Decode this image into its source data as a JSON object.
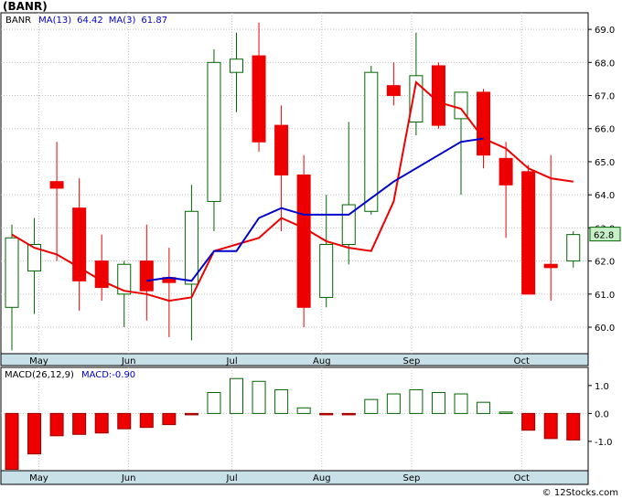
{
  "title": "(BANR)",
  "legend_price": [
    {
      "label": "BANR",
      "color": "#000000"
    },
    {
      "label": "MA(13)",
      "color": "#0000cc"
    },
    {
      "label": "64.42",
      "color": "#0000cc"
    },
    {
      "label": "MA(3)",
      "color": "#0000cc"
    },
    {
      "label": "61.87",
      "color": "#0000cc"
    }
  ],
  "legend_macd": [
    {
      "label": "MACD(26,12,9)",
      "color": "#000000"
    },
    {
      "label": "MACD:-0.90",
      "color": "#0000cc"
    }
  ],
  "last_price_label": "62.8",
  "credit": "© 12Stocks.com",
  "colors": {
    "up": "#006600",
    "down": "#ee0000",
    "ma13": "#0000cc",
    "ma3": "#ee0000",
    "panel_bg": "#ffffff",
    "axis_band": "#c8e0e8"
  },
  "chart_data": [
    {
      "type": "candlestick",
      "xlabels": [
        "May",
        "Jun",
        "Jul",
        "Aug",
        "Sep",
        "Oct"
      ],
      "xlabel_index": [
        1.2,
        5.2,
        9.8,
        13.8,
        17.8,
        22.7
      ],
      "ylim": [
        59.2,
        69.5
      ],
      "yticks": [
        60.0,
        61.0,
        62.0,
        63.0,
        64.0,
        65.0,
        66.0,
        67.0,
        68.0,
        69.0
      ],
      "candles": [
        {
          "o": 60.6,
          "h": 63.1,
          "l": 59.3,
          "c": 62.7
        },
        {
          "o": 61.7,
          "h": 63.3,
          "l": 60.4,
          "c": 62.5
        },
        {
          "o": 64.4,
          "h": 65.6,
          "l": 62.0,
          "c": 64.2
        },
        {
          "o": 63.6,
          "h": 64.5,
          "l": 60.5,
          "c": 61.4
        },
        {
          "o": 62.0,
          "h": 62.8,
          "l": 60.8,
          "c": 61.2
        },
        {
          "o": 61.0,
          "h": 62.0,
          "l": 60.0,
          "c": 61.9
        },
        {
          "o": 62.0,
          "h": 63.1,
          "l": 60.2,
          "c": 61.1
        },
        {
          "o": 61.5,
          "h": 62.4,
          "l": 59.7,
          "c": 61.35
        },
        {
          "o": 61.3,
          "h": 64.3,
          "l": 59.6,
          "c": 63.5
        },
        {
          "o": 63.8,
          "h": 68.4,
          "l": 62.9,
          "c": 68.0
        },
        {
          "o": 67.7,
          "h": 68.9,
          "l": 66.5,
          "c": 68.1
        },
        {
          "o": 68.2,
          "h": 69.2,
          "l": 65.3,
          "c": 65.6
        },
        {
          "o": 66.1,
          "h": 66.7,
          "l": 62.9,
          "c": 64.6
        },
        {
          "o": 64.6,
          "h": 65.2,
          "l": 60.0,
          "c": 60.6
        },
        {
          "o": 60.9,
          "h": 64.0,
          "l": 60.6,
          "c": 62.5
        },
        {
          "o": 62.5,
          "h": 66.2,
          "l": 61.9,
          "c": 63.7
        },
        {
          "o": 63.5,
          "h": 67.9,
          "l": 63.4,
          "c": 67.7
        },
        {
          "o": 67.3,
          "h": 68.0,
          "l": 66.7,
          "c": 67.0
        },
        {
          "o": 66.2,
          "h": 68.9,
          "l": 65.8,
          "c": 67.6
        },
        {
          "o": 67.9,
          "h": 68.0,
          "l": 66.0,
          "c": 66.1
        },
        {
          "o": 66.3,
          "h": 67.1,
          "l": 64.0,
          "c": 67.1
        },
        {
          "o": 67.1,
          "h": 67.2,
          "l": 64.8,
          "c": 65.2
        },
        {
          "o": 65.1,
          "h": 65.6,
          "l": 62.7,
          "c": 64.3
        },
        {
          "o": 64.7,
          "h": 64.9,
          "l": 61.0,
          "c": 61.0
        },
        {
          "o": 61.9,
          "h": 65.2,
          "l": 60.8,
          "c": 61.8
        },
        {
          "o": 62.0,
          "h": 62.9,
          "l": 61.8,
          "c": 62.8
        }
      ],
      "series": [
        {
          "name": "MA(13)",
          "x": [
            6,
            7,
            8,
            9,
            10,
            11,
            12,
            13,
            14,
            15,
            16,
            17,
            18,
            19,
            20,
            21
          ],
          "values": [
            61.4,
            61.5,
            61.4,
            62.3,
            62.3,
            63.3,
            63.6,
            63.4,
            63.4,
            63.4,
            63.9,
            64.4,
            64.8,
            65.2,
            65.6,
            65.7
          ]
        },
        {
          "name": "MA(3)",
          "x": [
            0,
            1,
            2,
            3,
            4,
            5,
            6,
            7,
            8,
            9,
            10,
            11,
            12,
            13,
            14,
            15,
            16,
            17,
            18,
            19,
            20,
            21,
            22,
            23,
            24,
            25
          ],
          "values": [
            62.8,
            62.4,
            62.2,
            61.8,
            61.4,
            61.1,
            61.0,
            60.8,
            60.9,
            62.3,
            62.5,
            62.7,
            63.3,
            63.0,
            62.6,
            62.4,
            62.3,
            63.8,
            67.4,
            66.8,
            66.6,
            65.7,
            65.4,
            64.8,
            64.5,
            64.4
          ]
        }
      ]
    },
    {
      "type": "bar",
      "name": "MACD(26,12,9)",
      "ylim": [
        -2.05,
        1.65
      ],
      "yticks": [
        1.0,
        0.0,
        -1.0
      ],
      "ytick_labels": [
        "1.0",
        "0.0",
        "-1.0"
      ],
      "xlabels": [
        "May",
        "Jun",
        "Jul",
        "Aug",
        "Sep",
        "Oct"
      ],
      "values": [
        -2.0,
        -1.45,
        -0.8,
        -0.75,
        -0.7,
        -0.55,
        -0.5,
        -0.4,
        -0.05,
        0.75,
        1.25,
        1.15,
        0.85,
        0.2,
        -0.05,
        -0.05,
        0.5,
        0.7,
        0.85,
        0.75,
        0.7,
        0.4,
        0.05,
        -0.6,
        -0.9,
        -0.95
      ]
    }
  ]
}
